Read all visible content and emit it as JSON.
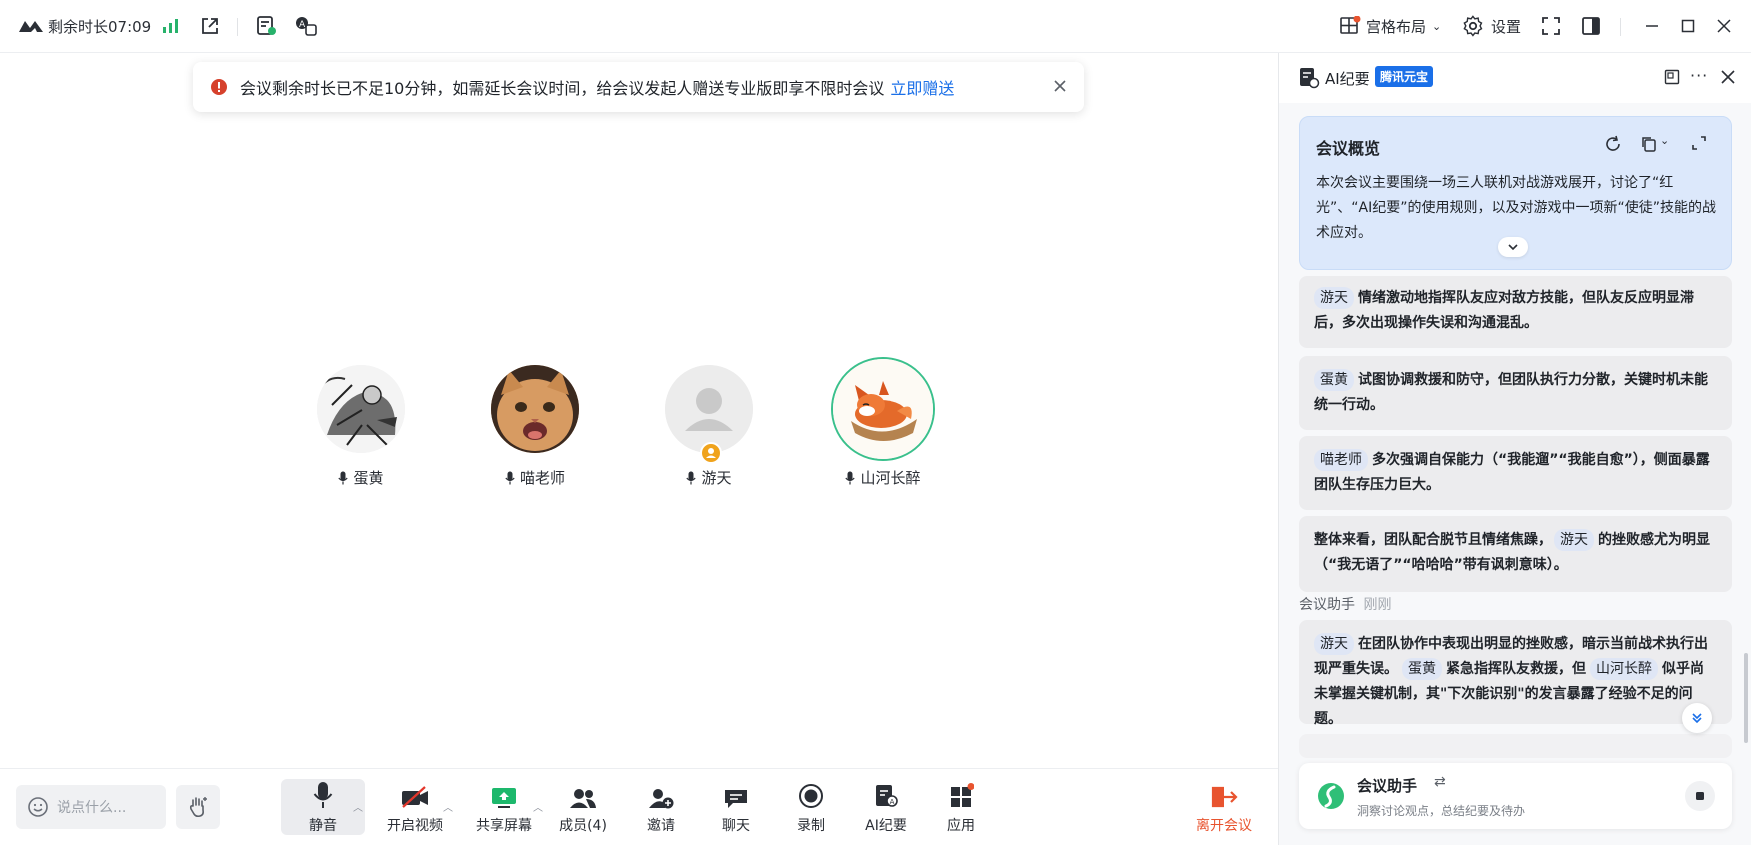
{
  "titlebar": {
    "time_remaining": "剩余时长07:09",
    "layout_label": "宫格布局",
    "settings_label": "设置"
  },
  "notice": {
    "message": "会议剩余时长已不足10分钟，如需延长会议时间，给会议发起人赠送专业版即享不限时会议",
    "link": "立即赠送"
  },
  "participants": [
    {
      "name": "蛋黄"
    },
    {
      "name": "喵老师"
    },
    {
      "name": "游天"
    },
    {
      "name": "山河长醉"
    }
  ],
  "toolbar": {
    "chat_placeholder": "说点什么...",
    "mute": "静音",
    "video": "开启视频",
    "share": "共享屏幕",
    "members": "成员(4)",
    "invite": "邀请",
    "chat": "聊天",
    "record": "录制",
    "ai": "AI纪要",
    "apps": "应用",
    "leave": "离开会议"
  },
  "panel": {
    "title": "AI纪要",
    "badge": "腾讯元宝",
    "overview": {
      "title": "会议概览",
      "body": "本次会议主要围绕一场三人联机对战游戏展开，讨论了“红光”、“AI纪要”的使用规则，以及对游戏中一项新“使徒”技能的战术应对。"
    },
    "cards": [
      {
        "tag": "游天",
        "text": "情绪激动地指挥队友应对敌方技能，但队友反应明显滞后，多次出现操作失误和沟通混乱。"
      },
      {
        "tag": "蛋黄",
        "text": "试图协调救援和防守，但团队执行力分散，关键时机未能统一行动。"
      },
      {
        "tag": "喵老师",
        "text": "多次强调自保能力（“我能遛”“我能自愈”），侧面暴露团队生存压力巨大。"
      }
    ],
    "summary": {
      "pre": "整体来看，团队配合脱节且情绪焦躁，",
      "tag": "游天",
      "post": "的挫败感尤为明显（“我无语了”“哈哈哈”带有讽刺意味）。"
    },
    "assistant_section": {
      "label": "会议助手",
      "time": "刚刚"
    },
    "assistant_card": {
      "tag1": "游天",
      "t1": "在团队协作中表现出明显的挫败感，暗示当前战术执行出现严重失误。",
      "tag2": "蛋黄",
      "t2": "紧急指挥队友救援，但",
      "tag3": "山河长醉",
      "t3": "似乎尚未掌握关键机制，其\"下次能识别\"的发言暴露了经验不足的问题。"
    },
    "assistant": {
      "title": "会议助手",
      "subtitle": "洞察讨论观点，总结纪要及待办"
    }
  },
  "colors": {
    "accent": "#1a6fe8",
    "leave": "#e8542f",
    "active_ring": "#3ac08c",
    "signal": "#27b26b"
  }
}
